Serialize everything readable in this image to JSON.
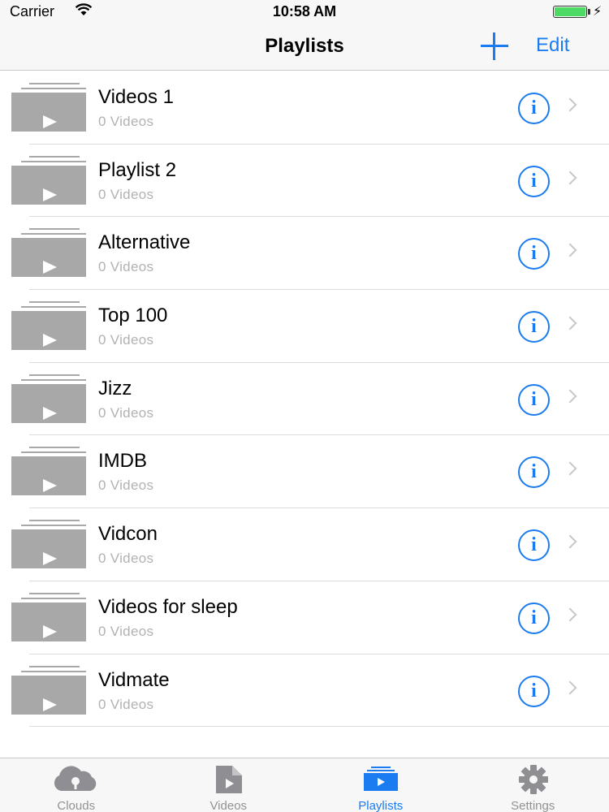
{
  "status_bar": {
    "carrier": "Carrier",
    "time": "10:58 AM",
    "battery_level": 1.0,
    "battery_color": "#4cd964",
    "icons": [
      "wifi-icon",
      "battery-icon",
      "charging-bolt-icon"
    ]
  },
  "nav": {
    "title": "Playlists",
    "add_icon": "plus-icon",
    "edit_label": "Edit",
    "accent_color": "#1a7cf0"
  },
  "playlists": [
    {
      "title": "Videos 1",
      "subtitle": "0 Videos"
    },
    {
      "title": "Playlist 2",
      "subtitle": "0 Videos"
    },
    {
      "title": "Alternative",
      "subtitle": "0 Videos"
    },
    {
      "title": "Top 100",
      "subtitle": "0 Videos"
    },
    {
      "title": "Jizz",
      "subtitle": "0 Videos"
    },
    {
      "title": "IMDB",
      "subtitle": "0 Videos"
    },
    {
      "title": "Vidcon",
      "subtitle": "0 Videos"
    },
    {
      "title": "Videos for sleep",
      "subtitle": "0 Videos"
    },
    {
      "title": "Vidmate",
      "subtitle": "0 Videos"
    }
  ],
  "row_icons": {
    "thumb": "playlist-thumbnail-icon",
    "info": "info-icon",
    "chevron": "chevron-right-icon",
    "info_glyph": "i"
  },
  "tabs": [
    {
      "label": "Clouds",
      "icon": "cloud-icon",
      "active": false
    },
    {
      "label": "Videos",
      "icon": "video-file-icon",
      "active": false
    },
    {
      "label": "Playlists",
      "icon": "playlist-icon",
      "active": true
    },
    {
      "label": "Settings",
      "icon": "gear-icon",
      "active": false
    }
  ]
}
